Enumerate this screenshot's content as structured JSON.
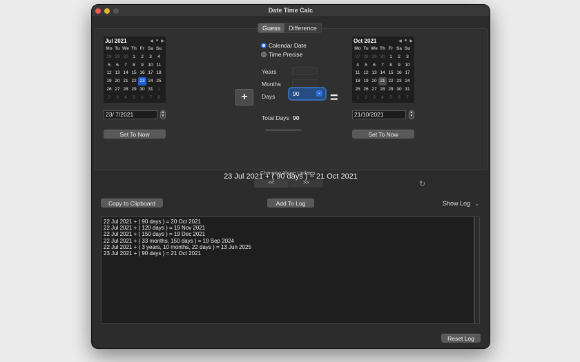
{
  "window": {
    "title": "Date Time Calc"
  },
  "tabs": [
    "Guess",
    "Difference"
  ],
  "left_calendar": {
    "month": "Jul 2021",
    "dow": [
      "Mo",
      "Tu",
      "We",
      "Th",
      "Fr",
      "Sa",
      "Su"
    ],
    "weeks": [
      [
        "28",
        "29",
        "30",
        "1",
        "2",
        "3",
        "4"
      ],
      [
        "5",
        "6",
        "7",
        "8",
        "9",
        "10",
        "11"
      ],
      [
        "12",
        "13",
        "14",
        "15",
        "16",
        "17",
        "18"
      ],
      [
        "19",
        "20",
        "21",
        "22",
        "23",
        "24",
        "25"
      ],
      [
        "26",
        "27",
        "28",
        "29",
        "30",
        "31",
        "1"
      ],
      [
        "2",
        "3",
        "4",
        "5",
        "6",
        "7",
        "8"
      ]
    ],
    "selected": "23",
    "date_field": "23/ 7/2021",
    "set_now": "Set To Now"
  },
  "right_calendar": {
    "month": "Oct 2021",
    "dow": [
      "Mo",
      "Tu",
      "We",
      "Th",
      "Fr",
      "Sa",
      "Su"
    ],
    "weeks": [
      [
        "27",
        "28",
        "29",
        "30",
        "1",
        "2",
        "3"
      ],
      [
        "4",
        "5",
        "6",
        "7",
        "8",
        "9",
        "10"
      ],
      [
        "11",
        "12",
        "13",
        "14",
        "15",
        "16",
        "17"
      ],
      [
        "18",
        "19",
        "20",
        "21",
        "22",
        "23",
        "24"
      ],
      [
        "25",
        "26",
        "27",
        "28",
        "29",
        "30",
        "31"
      ],
      [
        "1",
        "2",
        "3",
        "4",
        "5",
        "6",
        "7"
      ]
    ],
    "selected": "21",
    "date_field": "21/10/2021",
    "set_now": "Set To Now"
  },
  "mode": {
    "calendar_date": "Calendar Date",
    "time_precise": "Time Precise",
    "selected": "Calendar Date"
  },
  "fields": {
    "years_label": "Years",
    "months_label": "Months",
    "days_label": "Days",
    "days_value": "90",
    "total_days_label": "Total Days",
    "total_days_value": "90",
    "dashes": "-------------------------------"
  },
  "operator": "+",
  "equals": "=",
  "changing_label": "Changing Above Updates:",
  "arrow_left": "<<",
  "arrow_right": ">>",
  "result_text": "23 Jul 2021 + ( 90 days ) = 21 Oct 2021",
  "actions": {
    "copy": "Copy to Clipboard",
    "add_log": "Add To Log",
    "show_log": "Show Log",
    "reset_log": "Reset Log"
  },
  "log": [
    "22 Jul 2021 + ( 90 days ) = 20 Oct 2021",
    "22 Jul 2021 + ( 120 days ) = 19 Nov 2021",
    "22 Jul 2021 + ( 150 days ) = 19 Dec 2021",
    "22 Jul 2021 + ( 33 months, 150 days ) = 19 Sep 2024",
    "22 Jul 2021 + ( 3 years, 10 months, 22 days ) = 13 Jun 2025",
    "23 Jul 2021 + ( 90 days ) = 21 Oct 2021"
  ]
}
